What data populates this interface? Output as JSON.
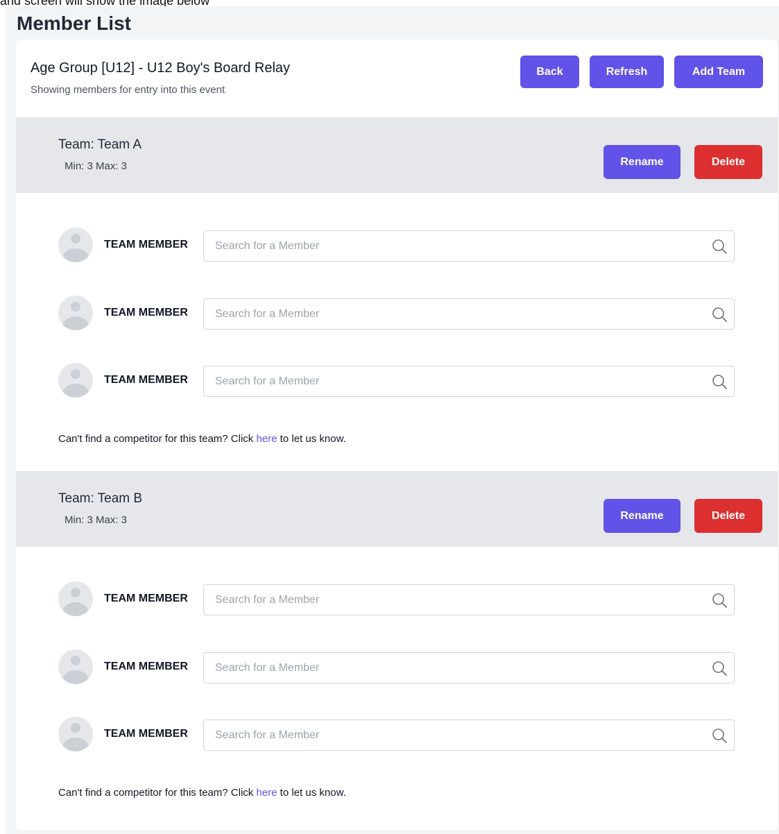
{
  "page": {
    "caption": "and screen will show the image below",
    "title": "Member List"
  },
  "event": {
    "title": "Age Group [U12] - U12 Boy's Board Relay",
    "subtitle": "Showing members for entry into this event"
  },
  "actions": {
    "back": "Back",
    "refresh": "Refresh",
    "add_team": "Add Team"
  },
  "colors": {
    "primary": "#6153e7",
    "danger": "#dc2f2f",
    "team_header_bg": "#e5e7eb",
    "page_bg": "#f3f4f6"
  },
  "icons": {
    "search": "search-icon",
    "avatar": "avatar-placeholder-icon"
  },
  "teams": [
    {
      "name": "Team: Team A",
      "limits": "Min: 3 Max: 3",
      "rename_label": "Rename",
      "delete_label": "Delete",
      "members": [
        {
          "label": "TEAM MEMBER",
          "placeholder": "Search for a Member",
          "value": ""
        },
        {
          "label": "TEAM MEMBER",
          "placeholder": "Search for a Member",
          "value": ""
        },
        {
          "label": "TEAM MEMBER",
          "placeholder": "Search for a Member",
          "value": ""
        }
      ],
      "help_prefix": "Can't find a competitor for this team? Click ",
      "help_link": "here",
      "help_suffix": " to let us know."
    },
    {
      "name": "Team: Team B",
      "limits": "Min: 3 Max: 3",
      "rename_label": "Rename",
      "delete_label": "Delete",
      "members": [
        {
          "label": "TEAM MEMBER",
          "placeholder": "Search for a Member",
          "value": ""
        },
        {
          "label": "TEAM MEMBER",
          "placeholder": "Search for a Member",
          "value": ""
        },
        {
          "label": "TEAM MEMBER",
          "placeholder": "Search for a Member",
          "value": ""
        }
      ],
      "help_prefix": "Can't find a competitor for this team? Click ",
      "help_link": "here",
      "help_suffix": " to let us know."
    }
  ]
}
